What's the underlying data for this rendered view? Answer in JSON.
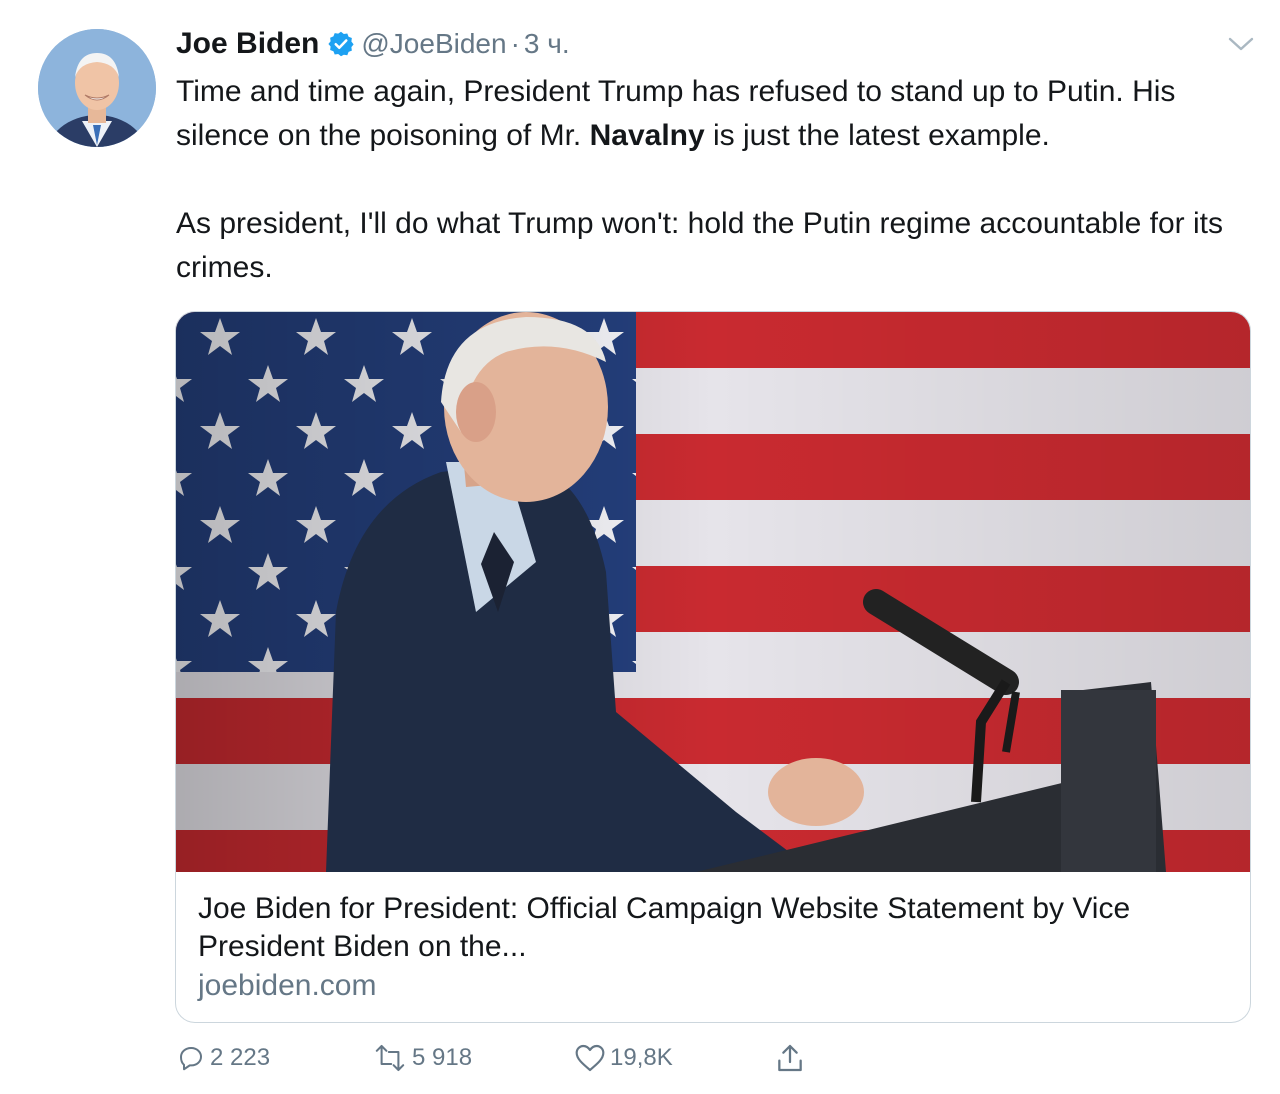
{
  "author": {
    "display_name": "Joe Biden",
    "handle": "@JoeBiden",
    "separator": "·",
    "timestamp": "3 ч.",
    "verified_icon": "verified-badge-icon",
    "verified_color": "#1da1f2"
  },
  "tweet": {
    "line1_pre": "Time and time again, President Trump has refused to stand up to Putin. His silence on the poisoning of Mr. ",
    "line1_bold": "Navalny",
    "line1_post": " is just the latest example.",
    "paragraph2": "As president, I'll do what Trump won't: hold the Putin regime accountable for its crimes."
  },
  "card": {
    "title": "Joe Biden for President: Official Campaign Website Statement by Vice President Biden on the...",
    "domain": "joebiden.com"
  },
  "actions": {
    "reply_count": "2 223",
    "retweet_count": "5 918",
    "like_count": "19,8K",
    "reply_icon": "reply-icon",
    "retweet_icon": "retweet-icon",
    "like_icon": "heart-icon",
    "share_icon": "share-icon",
    "icon_color": "#657786"
  }
}
